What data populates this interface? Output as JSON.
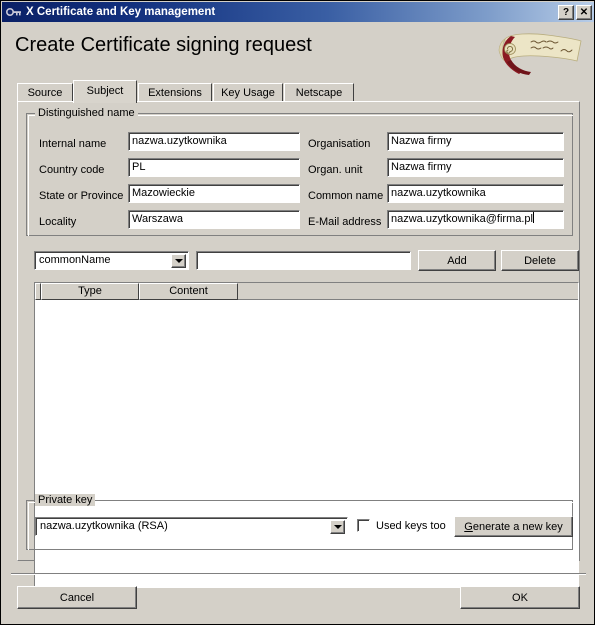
{
  "window": {
    "title": "X Certificate and Key management",
    "icon": "key-icon",
    "help_button": "?",
    "close_button": "✕"
  },
  "header": {
    "title": "Create Certificate signing request",
    "logo": "certificate-scroll-logo"
  },
  "tabs": [
    {
      "label": "Source",
      "active": false
    },
    {
      "label": "Subject",
      "active": true
    },
    {
      "label": "Extensions",
      "active": false
    },
    {
      "label": "Key Usage",
      "active": false
    },
    {
      "label": "Netscape",
      "active": false
    }
  ],
  "distinguished_name": {
    "group_title": "Distinguished name",
    "left_fields": [
      {
        "label": "Internal name",
        "value": "nazwa.uzytkownika",
        "placeholder": "",
        "focused": false
      },
      {
        "label": "Country code",
        "value": "PL",
        "placeholder": "",
        "focused": false
      },
      {
        "label": "State or Province",
        "value": "Mazowieckie",
        "placeholder": "",
        "focused": false
      },
      {
        "label": "Locality",
        "value": "Warszawa",
        "placeholder": "",
        "focused": false
      }
    ],
    "right_fields": [
      {
        "label": "Organisation",
        "value": "Nazwa firmy",
        "placeholder": "",
        "focused": false
      },
      {
        "label": "Organ. unit",
        "value": "Nazwa firmy",
        "placeholder": "",
        "focused": false
      },
      {
        "label": "Common name",
        "value": "nazwa.uzytkownika",
        "placeholder": "",
        "focused": false
      },
      {
        "label": "E-Mail address",
        "value": "nazwa.uzytkownika@firma.pl",
        "placeholder": "",
        "focused": true
      }
    ]
  },
  "extra_entry": {
    "type_combo": {
      "selected": "commonName",
      "options": [
        "commonName"
      ]
    },
    "value_input": {
      "value": "",
      "placeholder": ""
    },
    "add_button": "Add",
    "delete_button": "Delete"
  },
  "entries_table": {
    "columns": [
      "Type",
      "Content"
    ],
    "rows": []
  },
  "private_key": {
    "group_title": "Private key",
    "key_combo": {
      "selected": "nazwa.uzytkownika (RSA)",
      "options": [
        "nazwa.uzytkownika (RSA)"
      ]
    },
    "used_keys_checkbox": {
      "label": "Used keys too",
      "checked": false
    },
    "generate_button": {
      "label": "Generate a new key",
      "mnemonic": "G"
    }
  },
  "footer": {
    "cancel_button": "Cancel",
    "ok_button": "OK"
  },
  "colors": {
    "window_face": "#d4d0c8",
    "titlebar_start": "#0a2066",
    "titlebar_end": "#b8cde8",
    "field_background": "#ffffff",
    "text": "#000000",
    "logo_ribbon": "#8b1a22",
    "logo_parchment": "#ede6c8"
  }
}
